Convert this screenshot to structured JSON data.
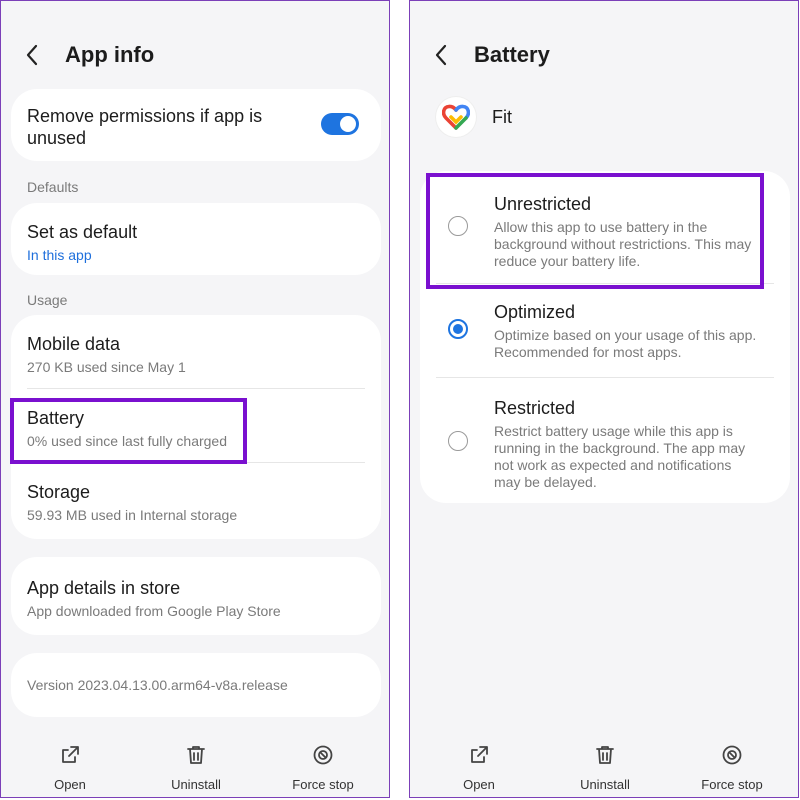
{
  "left": {
    "header": {
      "title": "App info"
    },
    "permissions": {
      "title": "Remove permissions if app is unused"
    },
    "sections": {
      "defaults": "Defaults",
      "usage": "Usage"
    },
    "set_default": {
      "title": "Set as default",
      "sub": "In this app"
    },
    "mobile_data": {
      "title": "Mobile data",
      "sub": "270 KB used since May 1"
    },
    "battery": {
      "title": "Battery",
      "sub": "0% used since last fully charged"
    },
    "storage": {
      "title": "Storage",
      "sub": "59.93 MB used in Internal storage"
    },
    "app_details": {
      "title": "App details in store",
      "sub": "App downloaded from Google Play Store"
    },
    "version": {
      "text": "Version 2023.04.13.00.arm64-v8a.release"
    },
    "bottom": {
      "open": "Open",
      "uninstall": "Uninstall",
      "force_stop": "Force stop"
    }
  },
  "right": {
    "header": {
      "title": "Battery"
    },
    "app": {
      "name": "Fit"
    },
    "options": [
      {
        "title": "Unrestricted",
        "desc": "Allow this app to use battery in the background without restrictions. This may reduce your battery life.",
        "selected": false
      },
      {
        "title": "Optimized",
        "desc": "Optimize based on your usage of this app. Recommended for most apps.",
        "selected": true
      },
      {
        "title": "Restricted",
        "desc": "Restrict battery usage while this app is running in the background. The app may not work as expected and notifications may be delayed.",
        "selected": false
      }
    ],
    "bottom": {
      "open": "Open",
      "uninstall": "Uninstall",
      "force_stop": "Force stop"
    }
  },
  "colors": {
    "accent": "#1e74e0",
    "highlight": "#7a10cf",
    "link": "#1e6fdc"
  },
  "icons": [
    "back-arrow-icon",
    "toggle-switch",
    "open-external-icon",
    "trash-icon",
    "force-stop-icon",
    "fit-heart-icon",
    "radio-button"
  ]
}
